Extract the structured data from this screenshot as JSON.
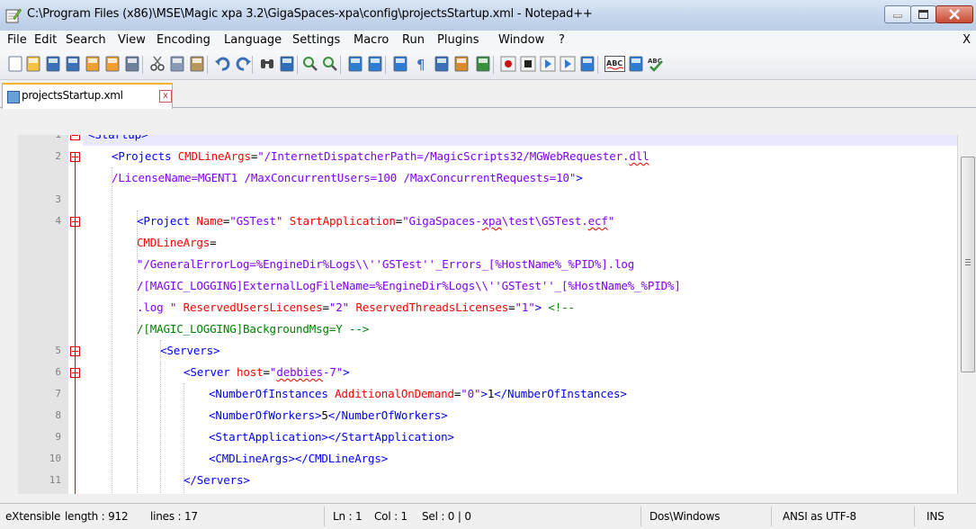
{
  "window": {
    "title": "C:\\Program Files (x86)\\MSE\\Magic xpa 3.2\\GigaSpaces-xpa\\config\\projectsStartup.xml - Notepad++"
  },
  "menu": {
    "items": [
      "File",
      "Edit",
      "Search",
      "View",
      "Encoding",
      "Language",
      "Settings",
      "Macro",
      "Run",
      "Plugins",
      "Window",
      "?"
    ],
    "close": "X"
  },
  "toolbar": {
    "icons": [
      "new-file",
      "open-file",
      "save",
      "save-all",
      "close",
      "close-all",
      "print",
      "cut",
      "copy",
      "paste",
      "undo",
      "redo",
      "find",
      "replace",
      "zoom-in",
      "zoom-out",
      "sync-vertical",
      "sync-horizontal",
      "word-wrap",
      "show-all-chars",
      "indent-guide",
      "user-defined-language",
      "doc-map",
      "record-macro",
      "stop-macro",
      "play-macro",
      "run-macro-multiple",
      "save-macro",
      "spell-check",
      "spell-check-settings",
      "spell-check-options"
    ]
  },
  "tab": {
    "label": "projectsStartup.xml",
    "close": "x"
  },
  "editor": {
    "rows": [
      {
        "num": "1",
        "current": true,
        "parts": [
          [
            "tag",
            "<Startup>"
          ]
        ]
      },
      {
        "num": "2",
        "parts": [
          [
            "tag",
            "<Projects "
          ],
          [
            "attr",
            "CMDLineArgs"
          ],
          [
            "txt",
            "="
          ],
          [
            "val",
            "\"/InternetDispatcherPath=/MagicScripts32/MGWebRequester."
          ],
          [
            "valws",
            "dll"
          ]
        ]
      },
      {
        "num": "",
        "parts": [
          [
            "val",
            "/LicenseName=MGENT1 /MaxConcurrentUsers=100 /MaxConcurrentRequests=10\""
          ],
          [
            "tag",
            ">"
          ]
        ]
      },
      {
        "num": "3",
        "parts": []
      },
      {
        "num": "4",
        "parts": [
          [
            "tag",
            "<Project "
          ],
          [
            "attr",
            "Name"
          ],
          [
            "txt",
            "="
          ],
          [
            "val",
            "\"GSTest\" "
          ],
          [
            "attr",
            "StartApplication"
          ],
          [
            "txt",
            "="
          ],
          [
            "val",
            "\"GigaSpaces-"
          ],
          [
            "valws",
            "xpa"
          ],
          [
            "val",
            "\\test\\GSTest."
          ],
          [
            "valws",
            "ecf"
          ],
          [
            "val",
            "\""
          ]
        ]
      },
      {
        "num": "",
        "parts": [
          [
            "attr",
            "CMDLineArgs"
          ],
          [
            "txt",
            "="
          ]
        ]
      },
      {
        "num": "",
        "parts": [
          [
            "val",
            "\"/GeneralErrorLog=%EngineDir%Logs\\\\''GSTest''_Errors_[%HostName%_%PID%].log"
          ]
        ]
      },
      {
        "num": "",
        "parts": [
          [
            "val",
            "/[MAGIC_LOGGING]ExternalLogFileName=%EngineDir%Logs\\\\''GSTest''_[%HostName%_%PID%]"
          ]
        ]
      },
      {
        "num": "",
        "parts": [
          [
            "val",
            ".log \" "
          ],
          [
            "attr",
            "ReservedUsersLicenses"
          ],
          [
            "txt",
            "="
          ],
          [
            "val",
            "\"2\" "
          ],
          [
            "attr",
            "ReservedThreadsLicenses"
          ],
          [
            "txt",
            "="
          ],
          [
            "val",
            "\"1\""
          ],
          [
            "tag",
            "> "
          ],
          [
            "cmt",
            "<!--"
          ]
        ]
      },
      {
        "num": "",
        "parts": [
          [
            "cmt",
            "/[MAGIC_LOGGING]BackgroundMsg=Y -->"
          ]
        ]
      },
      {
        "num": "5",
        "parts": [
          [
            "tag",
            "<Servers>"
          ]
        ]
      },
      {
        "num": "6",
        "parts": [
          [
            "tag",
            "<Server "
          ],
          [
            "attr",
            "host"
          ],
          [
            "txt",
            "="
          ],
          [
            "val",
            "\""
          ],
          [
            "valws",
            "debbies"
          ],
          [
            "val",
            "-7\""
          ],
          [
            "tag",
            ">"
          ]
        ]
      },
      {
        "num": "7",
        "parts": [
          [
            "tag",
            "<NumberOfInstances "
          ],
          [
            "attr",
            "AdditionalOnDemand"
          ],
          [
            "txt",
            "="
          ],
          [
            "val",
            "\"0\""
          ],
          [
            "tag",
            ">"
          ],
          [
            "txt",
            "1"
          ],
          [
            "tag",
            "</NumberOfInstances>"
          ]
        ]
      },
      {
        "num": "8",
        "parts": [
          [
            "tag",
            "<NumberOfWorkers>"
          ],
          [
            "txt",
            "5"
          ],
          [
            "tag",
            "</NumberOfWorkers>"
          ]
        ]
      },
      {
        "num": "9",
        "parts": [
          [
            "tag",
            "<StartApplication></StartApplication>"
          ]
        ]
      },
      {
        "num": "10",
        "parts": [
          [
            "tag",
            "<CMDLineArgs></CMDLineArgs>"
          ]
        ]
      },
      {
        "num": "11",
        "parts": [
          [
            "tag",
            "</Servers>"
          ]
        ]
      }
    ]
  },
  "status": {
    "file_type": "eXtensible",
    "length": "length : 912",
    "lines": "lines : 17",
    "ln": "Ln : 1",
    "col": "Col : 1",
    "sel": "Sel : 0 | 0",
    "eol": "Dos\\Windows",
    "encoding": "ANSI as UTF-8",
    "mode": "INS"
  }
}
